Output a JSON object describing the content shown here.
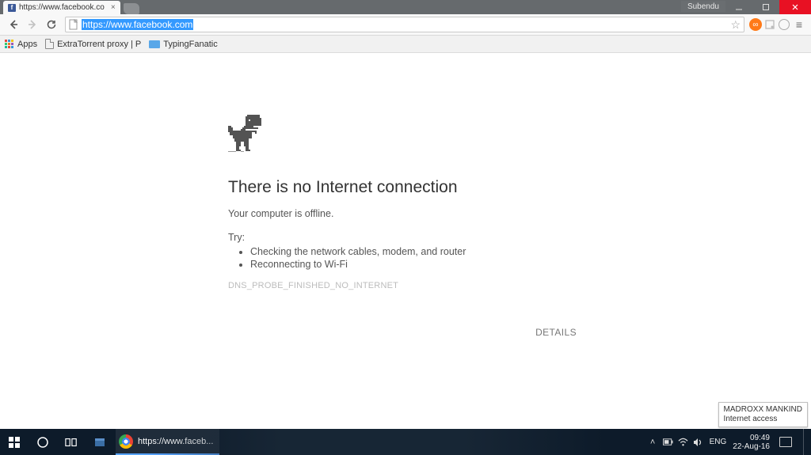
{
  "window": {
    "user_label": "Subendu"
  },
  "tab": {
    "title": "https://www.facebook.co"
  },
  "omnibox": {
    "url_selected": "https://www.facebook.com"
  },
  "bookmarks": {
    "apps": "Apps",
    "items": [
      {
        "label": "ExtraTorrent proxy | P"
      },
      {
        "label": "TypingFanatic"
      }
    ]
  },
  "error": {
    "title": "There is no Internet connection",
    "subtitle": "Your computer is offline.",
    "try_label": "Try:",
    "tips": [
      "Checking the network cables, modem, and router",
      "Reconnecting to Wi-Fi"
    ],
    "code": "DNS_PROBE_FINISHED_NO_INTERNET",
    "details_label": "DETAILS"
  },
  "tooltip": {
    "ssid": "MADROXX MANKIND",
    "status": "Internet access"
  },
  "taskbar": {
    "chrome_task": "https://www.faceb...",
    "lang": "ENG",
    "time": "09:49",
    "date": "22-Aug-16"
  }
}
